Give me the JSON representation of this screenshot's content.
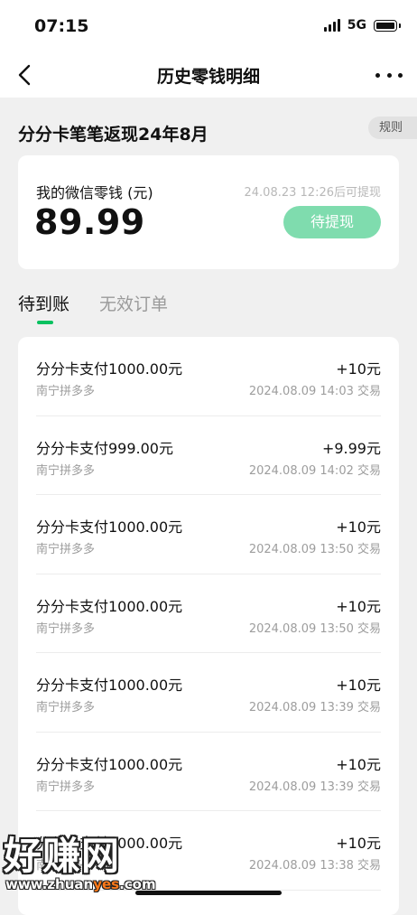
{
  "status_bar": {
    "time": "07:15",
    "network": "5G"
  },
  "nav": {
    "title": "历史零钱明细"
  },
  "campaign": {
    "title": "分分卡笔笔返现24年8月",
    "rule_label": "规则"
  },
  "balance": {
    "label": "我的微信零钱 (元)",
    "amount": "89.99",
    "withdraw_hint": "24.08.23 12:26后可提现",
    "withdraw_button": "待提现"
  },
  "tabs": [
    {
      "label": "待到账",
      "active": true
    },
    {
      "label": "无效订单",
      "active": false
    }
  ],
  "transactions": [
    {
      "title": "分分卡支付1000.00元",
      "merchant": "南宁拼多多",
      "amount": "+10元",
      "time": "2024.08.09 14:03 交易"
    },
    {
      "title": "分分卡支付999.00元",
      "merchant": "南宁拼多多",
      "amount": "+9.99元",
      "time": "2024.08.09 14:02 交易"
    },
    {
      "title": "分分卡支付1000.00元",
      "merchant": "南宁拼多多",
      "amount": "+10元",
      "time": "2024.08.09 13:50 交易"
    },
    {
      "title": "分分卡支付1000.00元",
      "merchant": "南宁拼多多",
      "amount": "+10元",
      "time": "2024.08.09 13:50 交易"
    },
    {
      "title": "分分卡支付1000.00元",
      "merchant": "南宁拼多多",
      "amount": "+10元",
      "time": "2024.08.09 13:39 交易"
    },
    {
      "title": "分分卡支付1000.00元",
      "merchant": "南宁拼多多",
      "amount": "+10元",
      "time": "2024.08.09 13:39 交易"
    },
    {
      "title": "分分卡支付1000.00元",
      "merchant": "南宁拼多多",
      "amount": "+10元",
      "time": "2024.08.09 13:38 交易"
    }
  ],
  "watermark": {
    "text": "好赚网",
    "url_prefix": "www.zhuan",
    "url_highlight": "yes",
    "url_suffix": ".com"
  },
  "colors": {
    "accent": "#07c160",
    "button": "#7fdcae",
    "background": "#f0f0f0"
  }
}
